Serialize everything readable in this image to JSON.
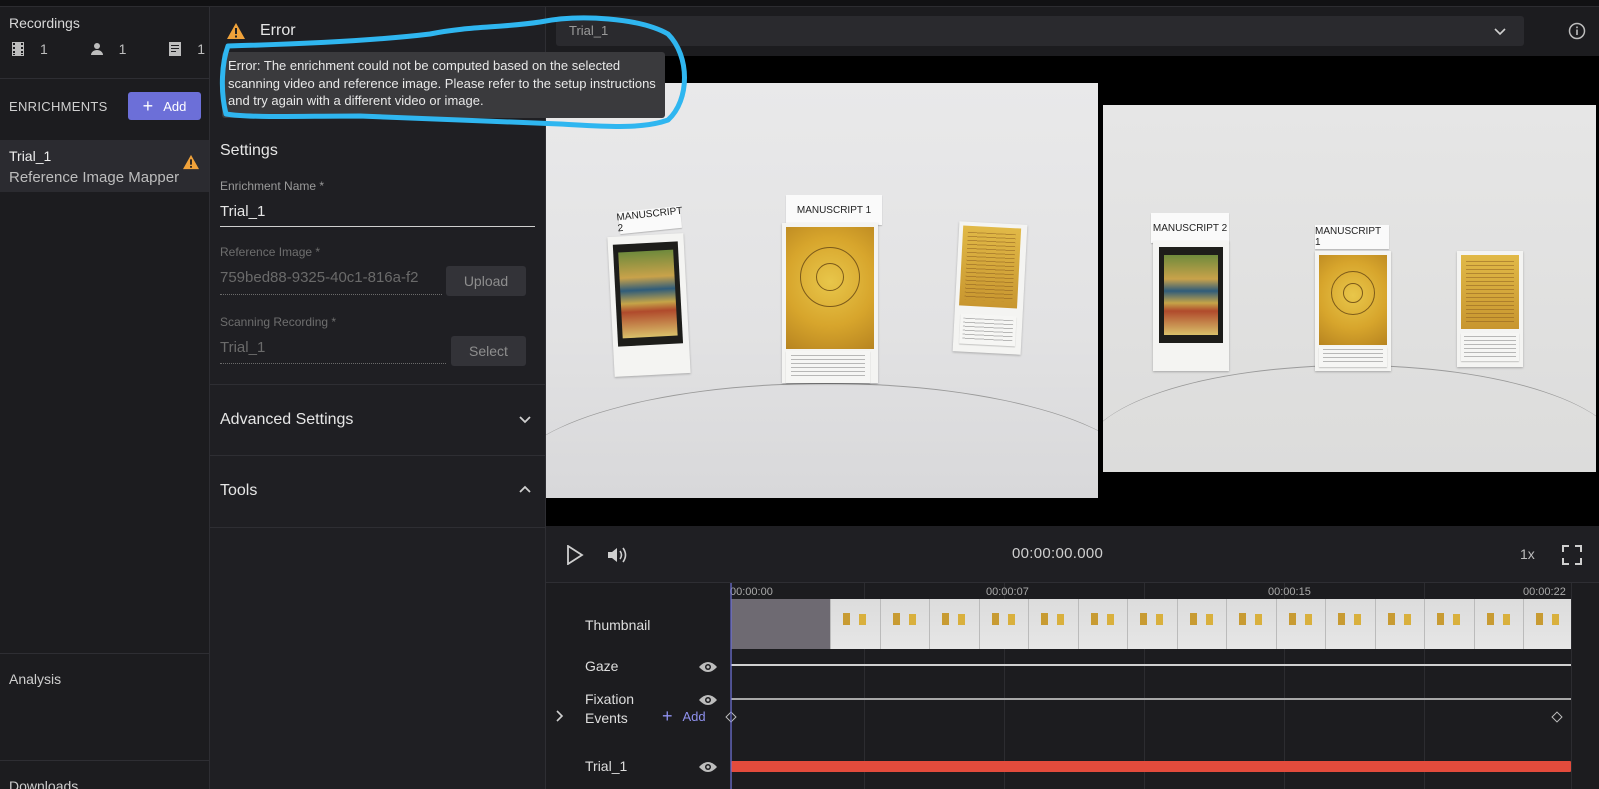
{
  "sidebar": {
    "recordings_title": "Recordings",
    "stats": [
      {
        "icon": "film-icon",
        "count": "1"
      },
      {
        "icon": "person-icon",
        "count": "1"
      },
      {
        "icon": "document-icon",
        "count": "1"
      }
    ],
    "enrichments_label": "ENRICHMENTS",
    "add_label": "Add",
    "enrichment_item": {
      "name": "Trial_1",
      "type": "Reference Image Mapper"
    },
    "analysis_label": "Analysis",
    "downloads_label": "Downloads"
  },
  "panel": {
    "error_title": "Error",
    "error_message": "Error: The enrichment could not be computed based on the selected scanning video and reference image. Please refer to the setup instructions and try again with a different video or image.",
    "settings_title": "Settings",
    "enrichment_name_label": "Enrichment Name *",
    "enrichment_name_value": "Trial_1",
    "reference_image_label": "Reference Image *",
    "reference_image_value": "759bed88-9325-40c1-816a-f2",
    "upload_label": "Upload",
    "scanning_recording_label": "Scanning Recording *",
    "scanning_recording_value": "Trial_1",
    "select_label": "Select",
    "advanced_settings_label": "Advanced Settings",
    "tools_label": "Tools"
  },
  "top": {
    "selector_value": "Trial_1"
  },
  "poster_labels": {
    "left_ms2": "MANUSCRIPT 2",
    "left_ms1": "MANUSCRIPT 1",
    "right_ms2": "MANUSCRIPT 2",
    "right_ms1": "MANUSCRIPT 1"
  },
  "player": {
    "timecode": "00:00:00.000",
    "speed": "1x"
  },
  "timeline": {
    "ticks": [
      "00:00:00",
      "00:00:07",
      "00:00:15",
      "00:00:22"
    ],
    "rows": {
      "thumbnail": "Thumbnail",
      "gaze": "Gaze",
      "fixation": "Fixation",
      "events": "Events",
      "events_add": "Add",
      "trial": "Trial_1"
    }
  },
  "colors": {
    "accent": "#6c6fd8",
    "warning": "#f0a23a",
    "highlight": "#2fb6f0",
    "trial_bar": "#e34b3c"
  }
}
